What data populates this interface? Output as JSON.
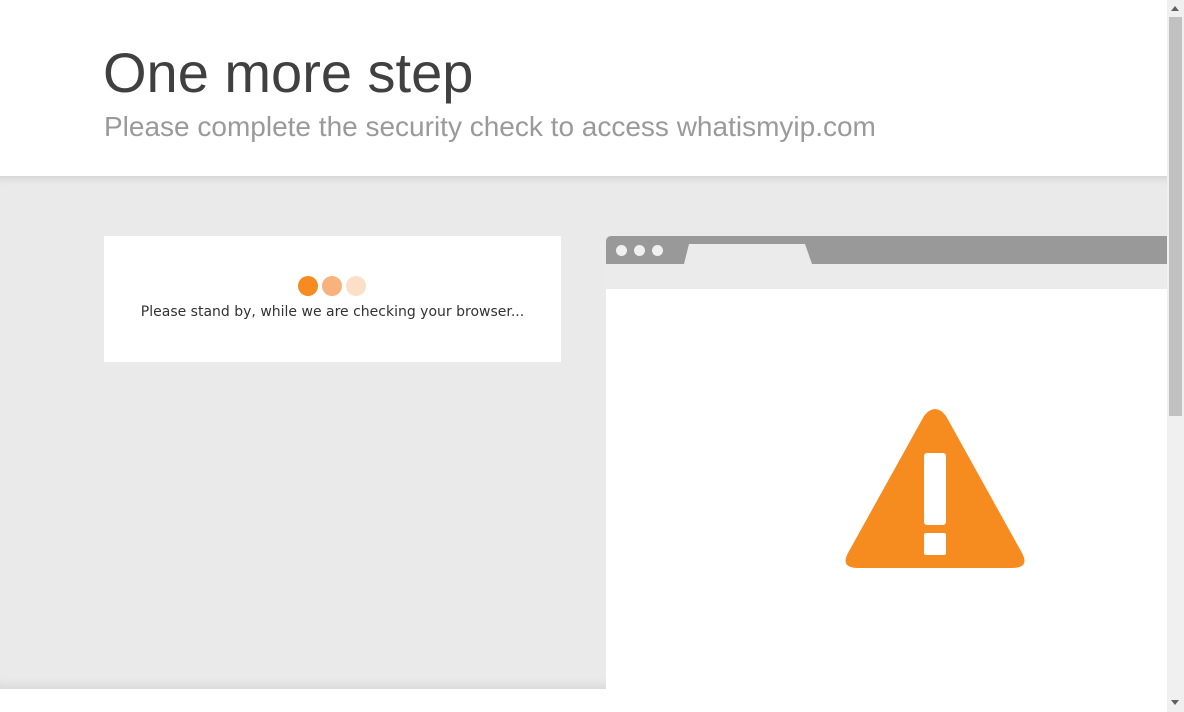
{
  "header": {
    "title": "One more step",
    "subtitle": "Please complete the security check to access whatismyip.com"
  },
  "status_card": {
    "message": "Please stand by, while we are checking your browser..."
  },
  "colors": {
    "accent": "#f68b1f",
    "dot2": "#f8b27b",
    "dot3": "#fbdfc6",
    "background": "#eaeaea"
  },
  "icons": [
    "loading-dots-icon",
    "warning-triangle-icon",
    "browser-window-illustration"
  ]
}
